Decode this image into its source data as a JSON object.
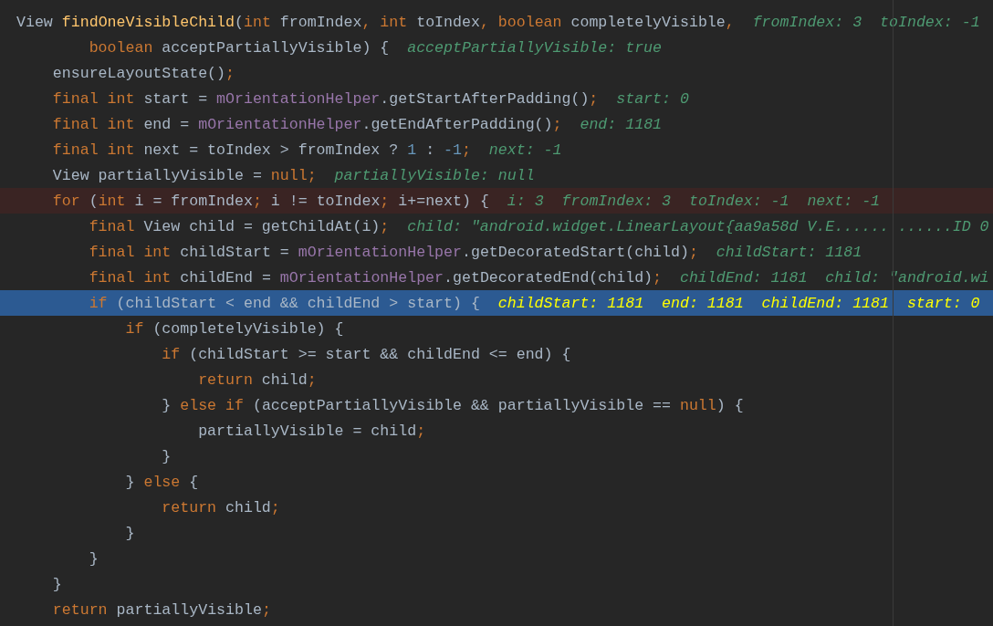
{
  "editor": {
    "lines": [
      {
        "kind": "normal",
        "tokens": [
          {
            "t": "View ",
            "kind": "plain"
          },
          {
            "t": "findOneVisibleChild",
            "kind": "method"
          },
          {
            "t": "(",
            "kind": "plain"
          },
          {
            "t": "int",
            "kind": "keyword"
          },
          {
            "t": " fromIndex",
            "kind": "plain"
          },
          {
            "t": ", int",
            "kind": "keyword"
          },
          {
            "t": " toIndex",
            "kind": "plain"
          },
          {
            "t": ", boolean",
            "kind": "keyword"
          },
          {
            "t": " completelyVisible",
            "kind": "plain"
          },
          {
            "t": ",",
            "kind": "keyword"
          }
        ],
        "value": "fromIndex: 3  toIndex: -1"
      },
      {
        "kind": "normal",
        "tokens": [
          {
            "t": "        boolean",
            "kind": "keyword"
          },
          {
            "t": " acceptPartiallyVisible) {",
            "kind": "plain"
          }
        ],
        "value": "acceptPartiallyVisible: true"
      },
      {
        "kind": "normal",
        "tokens": [
          {
            "t": "    ensureLayoutState()",
            "kind": "plain"
          },
          {
            "t": ";",
            "kind": "keyword"
          }
        ]
      },
      {
        "kind": "normal",
        "tokens": [
          {
            "t": "    final int",
            "kind": "keyword"
          },
          {
            "t": " start = ",
            "kind": "plain"
          },
          {
            "t": "mOrientationHelper",
            "kind": "field"
          },
          {
            "t": ".getStartAfterPadding()",
            "kind": "plain"
          },
          {
            "t": ";",
            "kind": "keyword"
          }
        ],
        "value": "start: 0"
      },
      {
        "kind": "normal",
        "tokens": [
          {
            "t": "    final int",
            "kind": "keyword"
          },
          {
            "t": " end = ",
            "kind": "plain"
          },
          {
            "t": "mOrientationHelper",
            "kind": "field"
          },
          {
            "t": ".getEndAfterPadding()",
            "kind": "plain"
          },
          {
            "t": ";",
            "kind": "keyword"
          }
        ],
        "value": "end: 1181"
      },
      {
        "kind": "normal",
        "tokens": [
          {
            "t": "    final int",
            "kind": "keyword"
          },
          {
            "t": " next = toIndex > fromIndex ? ",
            "kind": "plain"
          },
          {
            "t": "1",
            "kind": "number"
          },
          {
            "t": " : ",
            "kind": "plain"
          },
          {
            "t": "-1",
            "kind": "number"
          },
          {
            "t": ";",
            "kind": "keyword"
          }
        ],
        "value": "next: -1"
      },
      {
        "kind": "normal",
        "tokens": [
          {
            "t": "    View partiallyVisible = ",
            "kind": "plain"
          },
          {
            "t": "null;",
            "kind": "keyword"
          }
        ],
        "value": "partiallyVisible: null"
      },
      {
        "kind": "breakpoint",
        "tokens": [
          {
            "t": "    for",
            "kind": "keyword"
          },
          {
            "t": " (",
            "kind": "plain"
          },
          {
            "t": "int",
            "kind": "keyword"
          },
          {
            "t": " i = fromIndex",
            "kind": "plain"
          },
          {
            "t": ";",
            "kind": "keyword"
          },
          {
            "t": " i != toIndex",
            "kind": "plain"
          },
          {
            "t": ";",
            "kind": "keyword"
          },
          {
            "t": " i+=next) {",
            "kind": "plain"
          }
        ],
        "value": "i: 3  fromIndex: 3  toIndex: -1  next: -1"
      },
      {
        "kind": "normal",
        "tokens": [
          {
            "t": "        final",
            "kind": "keyword"
          },
          {
            "t": " View child = getChildAt(i)",
            "kind": "plain"
          },
          {
            "t": ";",
            "kind": "keyword"
          }
        ],
        "value": "child: \"android.widget.LinearLayout{aa9a58d V.E...... ......ID 0"
      },
      {
        "kind": "normal",
        "tokens": [
          {
            "t": "        final int",
            "kind": "keyword"
          },
          {
            "t": " childStart = ",
            "kind": "plain"
          },
          {
            "t": "mOrientationHelper",
            "kind": "field"
          },
          {
            "t": ".getDecoratedStart(child)",
            "kind": "plain"
          },
          {
            "t": ";",
            "kind": "keyword"
          }
        ],
        "value": "childStart: 1181"
      },
      {
        "kind": "normal",
        "tokens": [
          {
            "t": "        final int",
            "kind": "keyword"
          },
          {
            "t": " childEnd = ",
            "kind": "plain"
          },
          {
            "t": "mOrientationHelper",
            "kind": "field"
          },
          {
            "t": ".getDecoratedEnd(child)",
            "kind": "plain"
          },
          {
            "t": ";",
            "kind": "keyword"
          }
        ],
        "value": "childEnd: 1181  child: \"android.wi"
      },
      {
        "kind": "current",
        "tokens": [
          {
            "t": "        if",
            "kind": "keyword"
          },
          {
            "t": " (childStart < end && childEnd > start) {",
            "kind": "plain"
          }
        ],
        "value": "childStart: 1181  end: 1181  childEnd: 1181  start: 0"
      },
      {
        "kind": "normal",
        "tokens": [
          {
            "t": "            if",
            "kind": "keyword"
          },
          {
            "t": " (completelyVisible) {",
            "kind": "plain"
          }
        ]
      },
      {
        "kind": "normal",
        "tokens": [
          {
            "t": "                if",
            "kind": "keyword"
          },
          {
            "t": " (childStart >= start && childEnd <= end) {",
            "kind": "plain"
          }
        ]
      },
      {
        "kind": "normal",
        "tokens": [
          {
            "t": "                    return",
            "kind": "keyword"
          },
          {
            "t": " child",
            "kind": "plain"
          },
          {
            "t": ";",
            "kind": "keyword"
          }
        ]
      },
      {
        "kind": "normal",
        "tokens": [
          {
            "t": "                } ",
            "kind": "plain"
          },
          {
            "t": "else if",
            "kind": "keyword"
          },
          {
            "t": " (acceptPartiallyVisible && partiallyVisible == ",
            "kind": "plain"
          },
          {
            "t": "null",
            "kind": "keyword"
          },
          {
            "t": ") {",
            "kind": "plain"
          }
        ]
      },
      {
        "kind": "normal",
        "tokens": [
          {
            "t": "                    partiallyVisible = child",
            "kind": "plain"
          },
          {
            "t": ";",
            "kind": "keyword"
          }
        ]
      },
      {
        "kind": "normal",
        "tokens": [
          {
            "t": "                }",
            "kind": "plain"
          }
        ]
      },
      {
        "kind": "normal",
        "tokens": [
          {
            "t": "            } ",
            "kind": "plain"
          },
          {
            "t": "else",
            "kind": "keyword"
          },
          {
            "t": " {",
            "kind": "plain"
          }
        ]
      },
      {
        "kind": "normal",
        "tokens": [
          {
            "t": "                return",
            "kind": "keyword"
          },
          {
            "t": " child",
            "kind": "plain"
          },
          {
            "t": ";",
            "kind": "keyword"
          }
        ]
      },
      {
        "kind": "normal",
        "tokens": [
          {
            "t": "            }",
            "kind": "plain"
          }
        ]
      },
      {
        "kind": "normal",
        "tokens": [
          {
            "t": "        }",
            "kind": "plain"
          }
        ]
      },
      {
        "kind": "normal",
        "tokens": [
          {
            "t": "    }",
            "kind": "plain"
          }
        ]
      },
      {
        "kind": "normal",
        "tokens": [
          {
            "t": "    return",
            "kind": "keyword"
          },
          {
            "t": " partiallyVisible",
            "kind": "plain"
          },
          {
            "t": ";",
            "kind": "keyword"
          }
        ]
      }
    ]
  }
}
